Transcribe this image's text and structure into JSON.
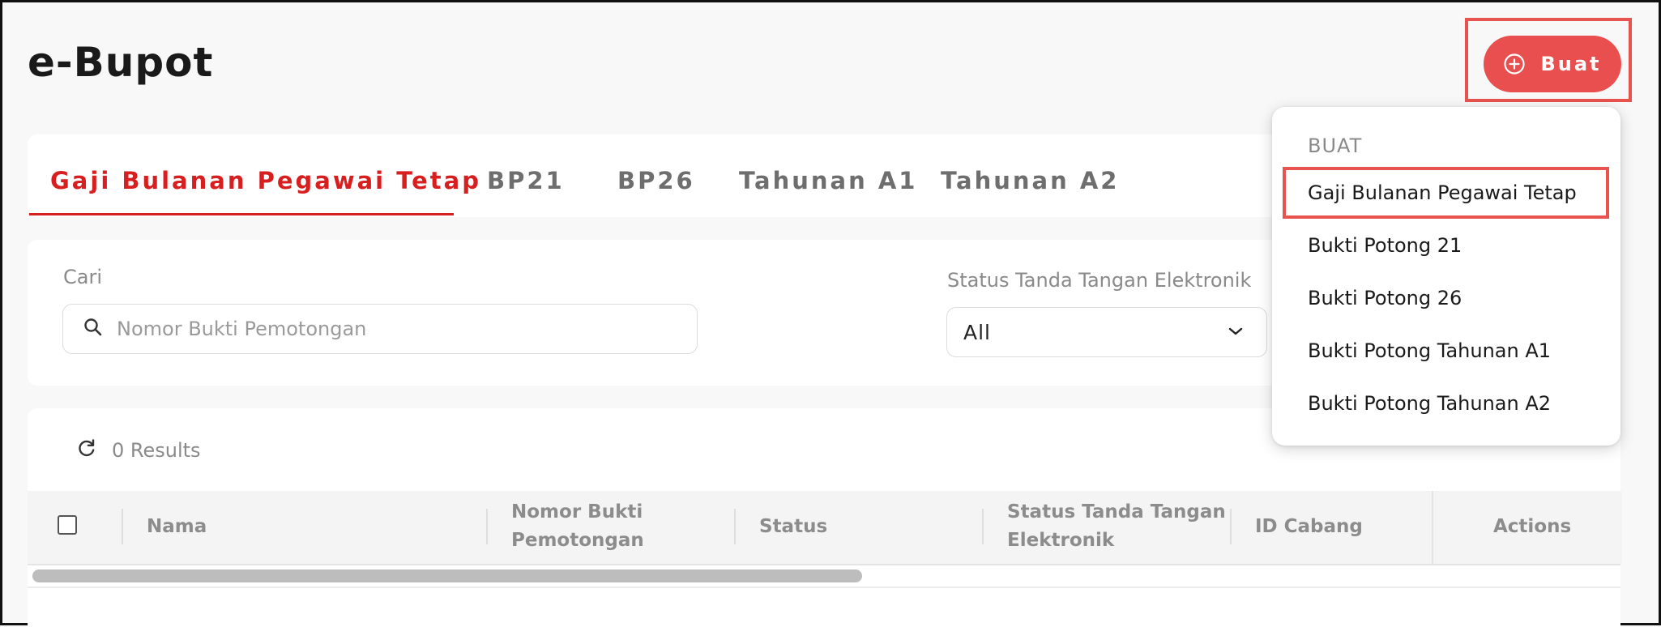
{
  "page": {
    "title": "e-Bupot"
  },
  "create_button": {
    "label": "Buat",
    "icon": "plus-circle-icon",
    "color": "#ea4f4f"
  },
  "tabs": [
    {
      "label": "Gaji Bulanan Pegawai Tetap",
      "active": true
    },
    {
      "label": "BP21",
      "active": false
    },
    {
      "label": "BP26",
      "active": false
    },
    {
      "label": "Tahunan A1",
      "active": false
    },
    {
      "label": "Tahunan A2",
      "active": false
    }
  ],
  "filters": {
    "search_label": "Cari",
    "search_placeholder": "Nomor Bukti Pemotongan",
    "search_value": "",
    "status_label": "Status Tanda Tangan Elektronik",
    "status_value": "All"
  },
  "results": {
    "text": "0 Results"
  },
  "table": {
    "columns": [
      {
        "line1": "Nama",
        "line2": ""
      },
      {
        "line1": "Nomor Bukti",
        "line2": "Pemotongan"
      },
      {
        "line1": "Status",
        "line2": ""
      },
      {
        "line1": "Status Tanda Tangan",
        "line2": "Elektronik"
      },
      {
        "line1": "ID Cabang",
        "line2": ""
      }
    ],
    "actions_header": "Actions"
  },
  "dropdown": {
    "header": "BUAT",
    "items": [
      "Gaji Bulanan Pegawai Tetap",
      "Bukti Potong 21",
      "Bukti Potong 26",
      "Bukti Potong Tahunan A1",
      "Bukti Potong Tahunan A2"
    ],
    "highlighted": "Gaji Bulanan Pegawai Tetap"
  },
  "colors": {
    "accent": "#d81f1f",
    "highlight_border": "#e8534e"
  }
}
